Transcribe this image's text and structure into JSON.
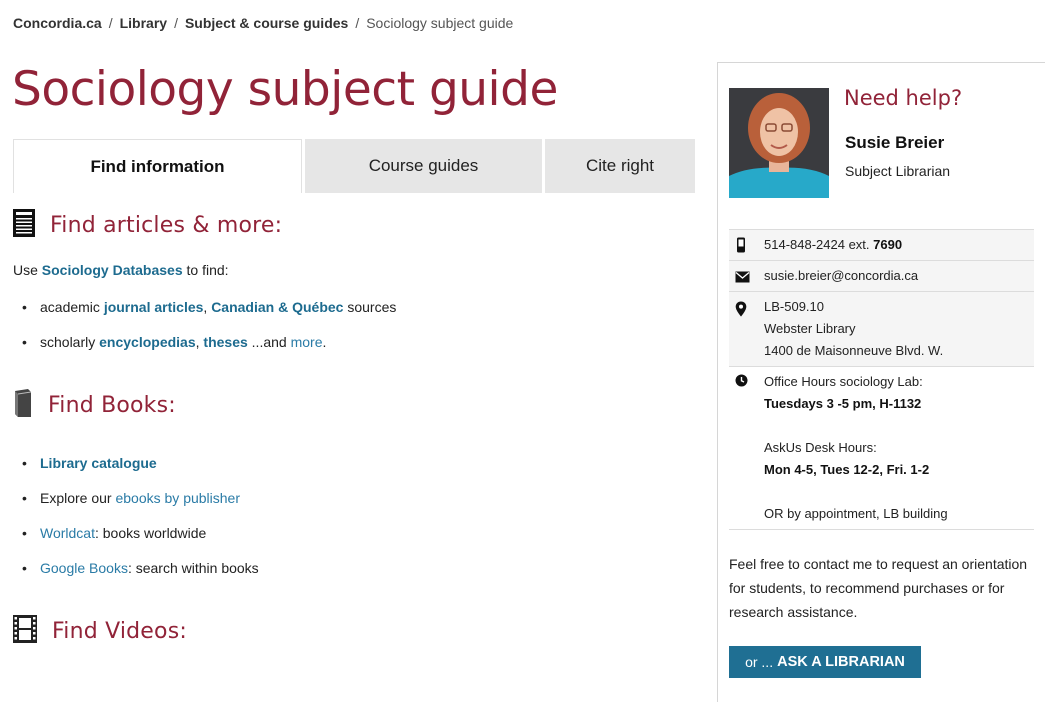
{
  "breadcrumb": {
    "items": [
      "Concordia.ca",
      "Library",
      "Subject & course guides"
    ],
    "separator": "/",
    "current": "Sociology subject guide"
  },
  "page": {
    "title": "Sociology subject guide"
  },
  "tabs": [
    {
      "label": "Find information",
      "active": true
    },
    {
      "label": "Course guides",
      "active": false
    },
    {
      "label": "Cite right",
      "active": false
    }
  ],
  "articles": {
    "heading": "Find articles & more:",
    "icon": "newspaper-icon",
    "intro_prefix": "Use ",
    "intro_link": "Sociology Databases",
    "intro_suffix": " to find:",
    "bullet1": {
      "prefix": "academic ",
      "link1": "journal articles",
      "sep": ", ",
      "link2": "Canadian & Québec",
      "suffix": " sources"
    },
    "bullet2": {
      "prefix": "scholarly ",
      "link1": "encyclopedias",
      "sep": ", ",
      "link2": "theses",
      "middle": " ...and ",
      "link3": "more",
      "suffix": "."
    }
  },
  "books": {
    "heading": "Find Books:",
    "icon": "book-icon",
    "item1": {
      "link": "Library catalogue"
    },
    "item2": {
      "prefix": "Explore our ",
      "link": "ebooks by publisher"
    },
    "item3": {
      "link": "Worldcat",
      "suffix": ": books worldwide"
    },
    "item4": {
      "link": "Google Books",
      "suffix": ": search within books"
    }
  },
  "videos": {
    "heading": "Find Videos:",
    "icon": "film-icon"
  },
  "sidebar": {
    "heading": "Need help?",
    "librarian": {
      "name": "Susie Breier",
      "role": "Subject Librarian"
    },
    "phone": {
      "number": "514-848-2424 ext. ",
      "extension": "7690",
      "icon": "phone-icon"
    },
    "email": {
      "address": "susie.breier@concordia.ca",
      "icon": "envelope-icon"
    },
    "location": {
      "lines": [
        "LB-509.10",
        "Webster Library",
        "1400 de Maisonneuve Blvd. W."
      ],
      "icon": "map-pin-icon"
    },
    "hours": {
      "icon": "clock-icon",
      "line1": "Office Hours sociology Lab:",
      "line1_bold": "Tuesdays 3 -5 pm, H-1132",
      "line2": "AskUs Desk Hours:",
      "line2_bold": "Mon 4-5, Tues 12-2, Fri. 1-2",
      "line3": "OR by appointment, LB building"
    },
    "note": "Feel free to contact me to request an orientation for students, to recommend purchases or for research assistance.",
    "button": {
      "prefix": "or ...",
      "label": "ASK A LIBRARIAN"
    }
  },
  "colors": {
    "accent": "#912338",
    "link": "#1d6b8f",
    "button": "#1f6f93",
    "tab_inactive": "#e6e6e6"
  }
}
